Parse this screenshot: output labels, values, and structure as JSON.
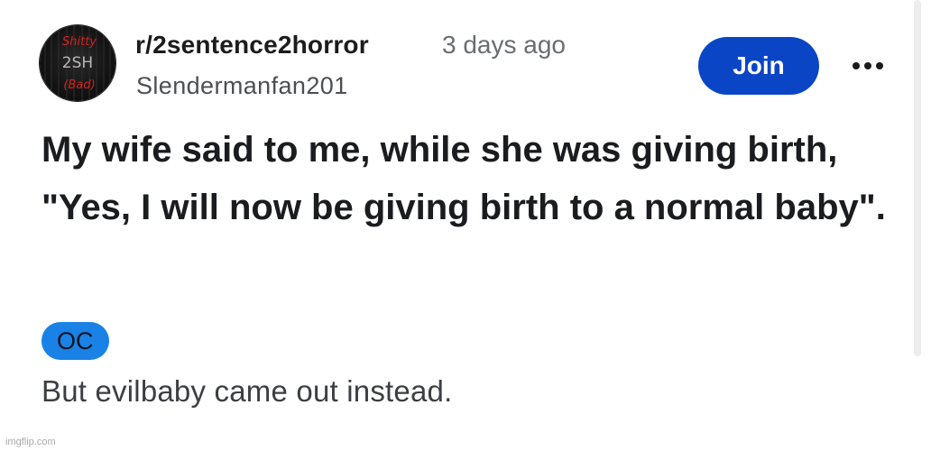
{
  "header": {
    "avatar_lines": [
      "Shitty",
      "2SH",
      "(Bad)"
    ],
    "subreddit": "r/2sentence2horror",
    "timestamp": "3 days ago",
    "username": "Slendermanfan201",
    "join_label": "Join",
    "more_icon": "more-horizontal-icon"
  },
  "post": {
    "title": "My wife said to me, while she was giving birth, \"Yes, I will now be giving birth to a normal baby\".",
    "flair": "OC",
    "body": "But evilbaby came out instead."
  },
  "colors": {
    "join_button": "#0a45c6",
    "flair": "#1a82e6",
    "avatar_text": "#d9201e"
  },
  "watermark": "imgflip.com"
}
